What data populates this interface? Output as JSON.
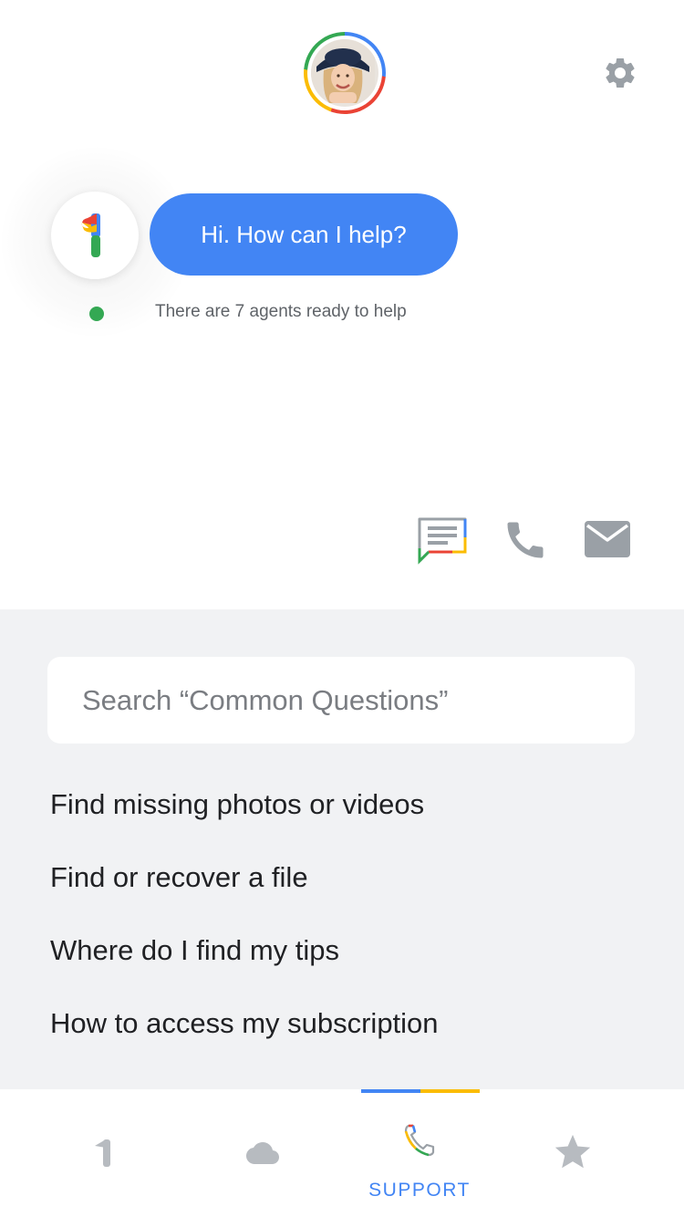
{
  "header": {
    "avatar": "user-avatar",
    "settings_icon": "gear-icon"
  },
  "assistant": {
    "logo_icon": "google-one-logo-icon",
    "greeting": "Hi. How can I help?",
    "agents_status": "There are 7 agents ready to help",
    "status_color": "#34a853"
  },
  "contact_actions": [
    {
      "icon": "chat-icon"
    },
    {
      "icon": "phone-icon"
    },
    {
      "icon": "mail-icon"
    }
  ],
  "search": {
    "placeholder": "Search “Common Questions”",
    "value": ""
  },
  "faq": [
    {
      "label": "Find missing photos or videos"
    },
    {
      "label": "Find or recover a file"
    },
    {
      "label": "Where do I find my tips"
    },
    {
      "label": "How to access my subscription"
    }
  ],
  "tabs": [
    {
      "icon": "google-one-icon",
      "label": ""
    },
    {
      "icon": "cloud-icon",
      "label": ""
    },
    {
      "icon": "support-phone-icon",
      "label": "SUPPORT",
      "active": true
    },
    {
      "icon": "star-icon",
      "label": ""
    }
  ],
  "colors": {
    "accent": "#4285f4",
    "red": "#ea4335",
    "yellow": "#fbbc04",
    "green": "#34a853",
    "icon_gray": "#9aa0a6",
    "panel_bg": "#f1f2f4"
  }
}
